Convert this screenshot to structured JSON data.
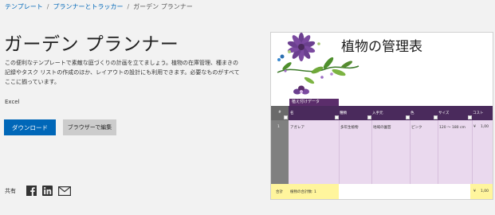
{
  "breadcrumb": {
    "items": [
      "テンプレート",
      "プランナーとトラッカー"
    ],
    "current": "ガーデン プランナー",
    "separator": "/"
  },
  "page_title": "ガーデン プランナー",
  "description": "この便利なテンプレートで素敵な庭づくりの計画を立てましょう。植物の在庫管理、種まきの記録やタスク リストの作成のほか、レイアウトの設計にも利用できます。必要なものがすべてここに揃っています。",
  "app_name": "Excel",
  "buttons": {
    "download": "ダウンロード",
    "edit_in_browser": "ブラウザーで編集"
  },
  "share": {
    "label": "共有",
    "icons": [
      "facebook-icon",
      "linkedin-icon",
      "mail-icon"
    ]
  },
  "colors": {
    "accent": "#0067b8",
    "header_purple": "#4a2a5c",
    "row_lilac": "#ead9ee",
    "total_yellow": "#fff59d"
  },
  "preview": {
    "title": "植物の管理表",
    "tab_label": "植え付けデータ",
    "headers": [
      "#",
      "名",
      "種類",
      "入手元",
      "色",
      "サイズ",
      "コスト"
    ],
    "row": {
      "num": "1",
      "name": "アガレア",
      "type": "多年生植物",
      "source": "地域の園芸",
      "color": "ピンク",
      "size": "120 〜 180 cm",
      "cost_symbol": "¥",
      "cost_value": "1,00"
    },
    "total": {
      "label": "合計",
      "text": "植物の合計数: 1",
      "cost_symbol": "¥",
      "cost_value": "1,00"
    }
  }
}
